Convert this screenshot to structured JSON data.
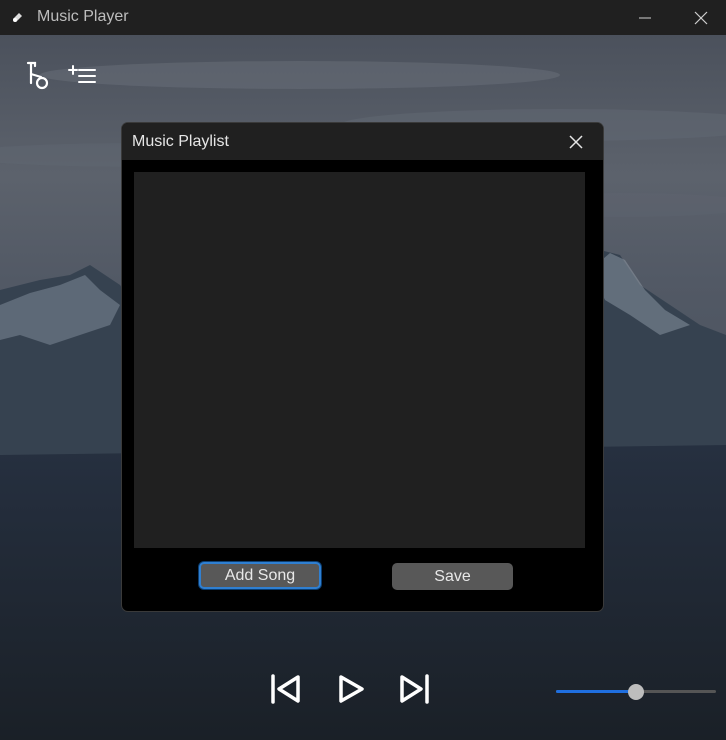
{
  "window": {
    "title": "Music Player",
    "icons": [
      "app-icon",
      "minimize-icon",
      "close-icon"
    ]
  },
  "toolbar": {
    "icons": [
      "music-note-icon",
      "add-to-playlist-icon"
    ]
  },
  "playlist_dialog": {
    "title": "Music Playlist",
    "songs": [],
    "add_song_label": "Add Song",
    "save_label": "Save"
  },
  "player": {
    "icons": [
      "previous-track-icon",
      "play-icon",
      "next-track-icon"
    ],
    "volume": 0.5
  },
  "colors": {
    "accent": "#1f6fe0",
    "focus_border": "#2f7fd1",
    "button": "#585858",
    "list_bg": "#202020"
  }
}
